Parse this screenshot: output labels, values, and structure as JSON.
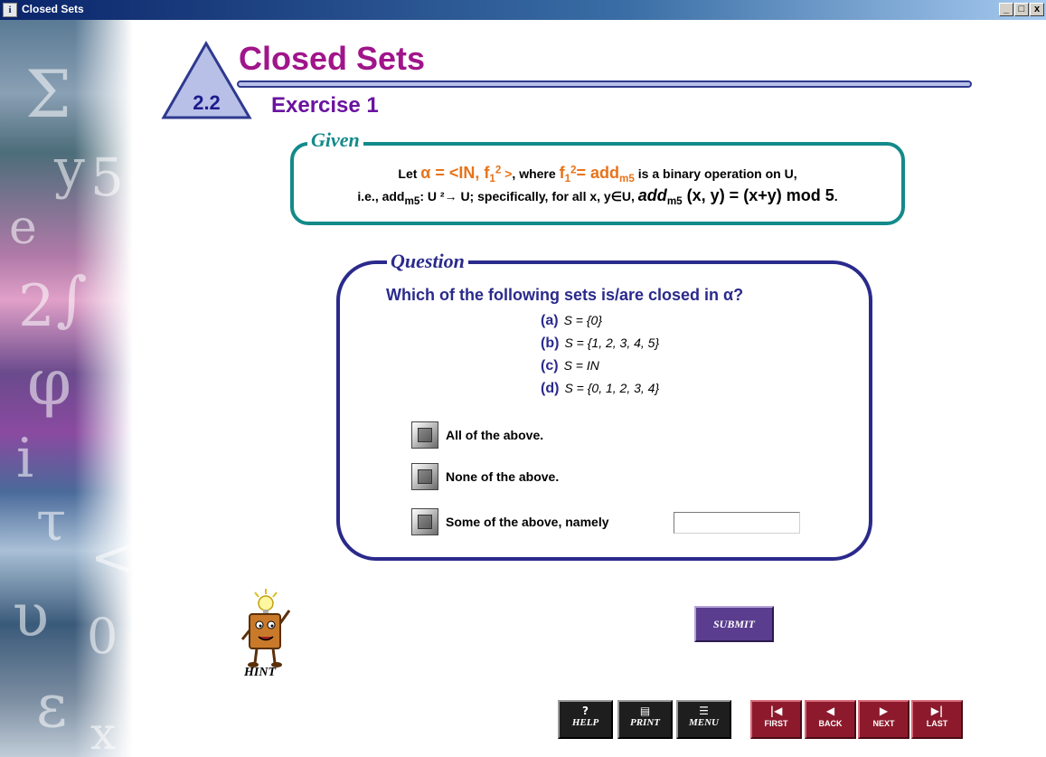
{
  "window": {
    "title": "Closed Sets",
    "minimize": "_",
    "maximize": "□",
    "close": "x"
  },
  "header": {
    "title": "Closed Sets",
    "section_number": "2.2",
    "subtitle": "Exercise 1"
  },
  "given": {
    "label": "Given",
    "line1": {
      "pre": "Let ",
      "alpha_def": "α = <IN, f",
      "alpha_close": " >",
      "mid": ", where ",
      "f_def": "f",
      "eq": "= add",
      "mod_sub": "m5",
      "post": " is a binary operation on U,"
    },
    "line2": {
      "pre": "i.e., add",
      "mod_sub": "m5",
      "mapping": ": U ²→ U; specifically, for all x, y∈U, ",
      "add_bold": "add",
      "formula": " (x, y) = (x+y) mod 5",
      "end": "."
    }
  },
  "question": {
    "label": "Question",
    "text": "Which of the following sets is/are closed in α?",
    "options": [
      {
        "letter": "(a)",
        "text": "S = {0}"
      },
      {
        "letter": "(b)",
        "text": "S = {1, 2, 3, 4, 5}"
      },
      {
        "letter": "(c)",
        "text": "S = IN"
      },
      {
        "letter": "(d)",
        "text": "S = {0, 1, 2, 3, 4}"
      }
    ],
    "choices": [
      {
        "label": "All of the above."
      },
      {
        "label": "None of the above."
      },
      {
        "label": "Some of the above, namely"
      }
    ],
    "namely_value": ""
  },
  "actions": {
    "submit": "SUBMIT",
    "hint": "HINT"
  },
  "nav": {
    "help": "HELP",
    "print": "PRINT",
    "menu": "MENU",
    "first": "FIRST",
    "back": "BACK",
    "next": "NEXT",
    "last": "LAST"
  },
  "colors": {
    "title": "#a0158a",
    "subtitle": "#6a13a0",
    "given": "#138a8a",
    "question": "#2a2a8c",
    "highlight": "#e8731a"
  }
}
